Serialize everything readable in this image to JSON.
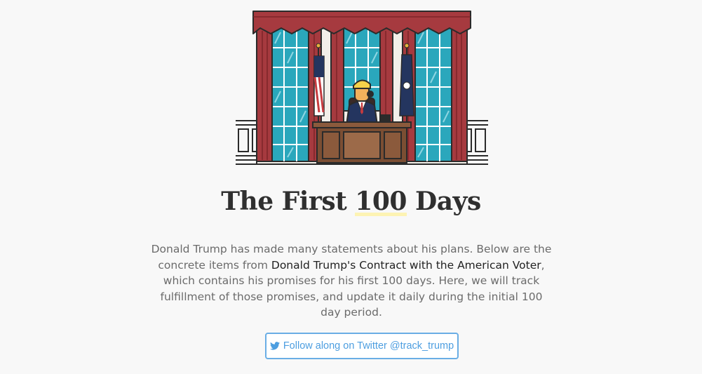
{
  "hero": {
    "illustration": "oval-office-illustration"
  },
  "header": {
    "title_before": "The First ",
    "title_highlight": "100",
    "title_after": " Days"
  },
  "intro": {
    "text_1": "Donald Trump has made many statements about his plans. Below are the concrete items from ",
    "link_label": "Donald Trump's Contract with the American Voter",
    "text_2": ", which contains his promises for his first 100 days. Here, we will track fulfillment of those promises, and update it daily during the initial 100 day period."
  },
  "follow": {
    "icon": "twitter-bird-icon",
    "label": "Follow along on Twitter @track_trump"
  },
  "colors": {
    "background": "#f8f8f8",
    "title": "#2f2f2f",
    "body_text": "#6b6b6b",
    "highlight": "#fdf3b3",
    "button_accent": "#4d9ee0",
    "curtain": "#a63a3f",
    "window_glass": "#2aa7bc"
  }
}
